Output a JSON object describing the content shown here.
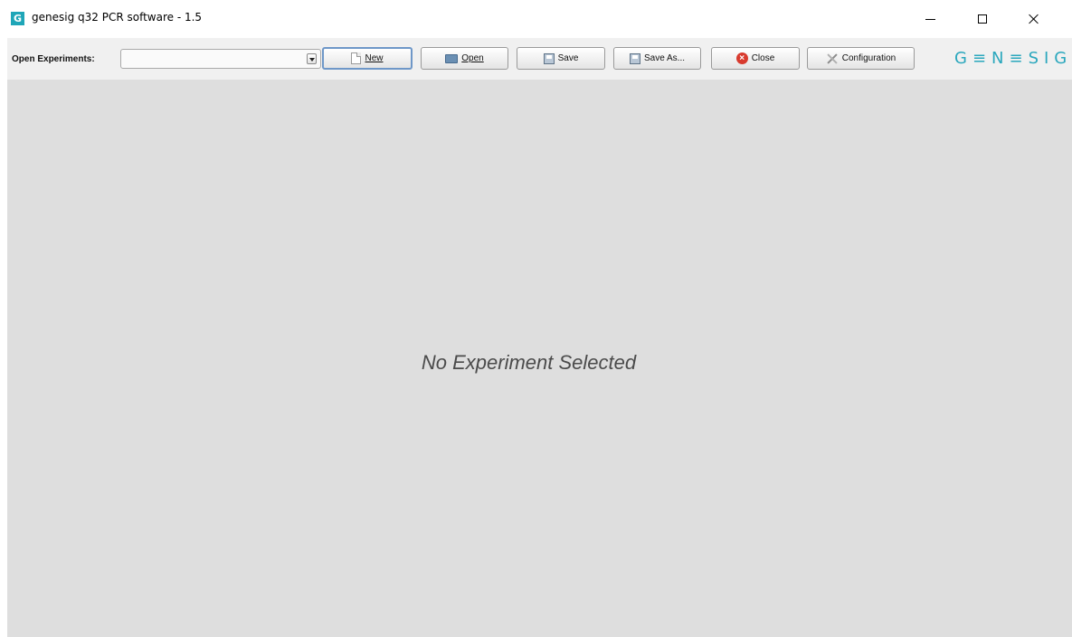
{
  "window": {
    "icon_letter": "G",
    "title": "genesig q32 PCR software - 1.5"
  },
  "toolbar": {
    "label": "Open Experiments:",
    "experiment_select_value": "",
    "buttons": {
      "new": "New",
      "open": "Open",
      "save": "Save",
      "save_as": "Save As...",
      "close": "Close",
      "configuration": "Configuration"
    },
    "brand": "G≡N≡SIG"
  },
  "main": {
    "empty_message": "No Experiment Selected"
  },
  "colors": {
    "brand": "#2aa7bd",
    "canvas": "#dedede",
    "toolbar": "#f0f0f0",
    "close_icon": "#d83a2e"
  },
  "icons": {
    "new": "new-document-icon",
    "open": "folder-icon",
    "save": "disk-icon",
    "save_as": "disk-icon",
    "close": "close-circle-icon",
    "configuration": "tools-icon"
  }
}
